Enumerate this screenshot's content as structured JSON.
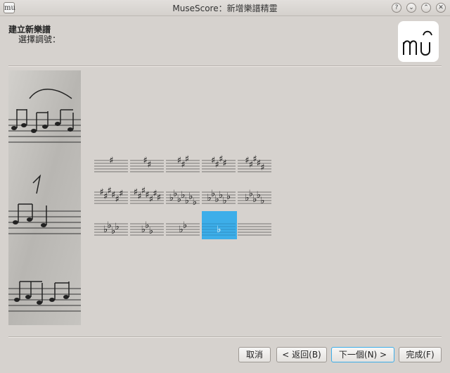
{
  "window": {
    "title": "MuseScore：新增樂譜精靈",
    "app_icon_text": "mu",
    "controls": {
      "help": "?",
      "minimize": "⌄",
      "maximize": "⌃",
      "close": "✕"
    }
  },
  "header": {
    "title": "建立新樂譜",
    "subtitle": "選擇調號："
  },
  "logo": {
    "icon": "musescore-logo"
  },
  "keys": [
    {
      "type": "sharp",
      "count": 1,
      "selected": false
    },
    {
      "type": "sharp",
      "count": 2,
      "selected": false
    },
    {
      "type": "sharp",
      "count": 3,
      "selected": false
    },
    {
      "type": "sharp",
      "count": 4,
      "selected": false
    },
    {
      "type": "sharp",
      "count": 5,
      "selected": false
    },
    {
      "type": "sharp",
      "count": 6,
      "selected": false
    },
    {
      "type": "sharp",
      "count": 7,
      "selected": false
    },
    {
      "type": "flat",
      "count": 7,
      "selected": false
    },
    {
      "type": "flat",
      "count": 6,
      "selected": false
    },
    {
      "type": "flat",
      "count": 5,
      "selected": false
    },
    {
      "type": "flat",
      "count": 4,
      "selected": false
    },
    {
      "type": "flat",
      "count": 3,
      "selected": false
    },
    {
      "type": "flat",
      "count": 2,
      "selected": false
    },
    {
      "type": "flat",
      "count": 1,
      "selected": true
    },
    {
      "type": "none",
      "count": 0,
      "selected": false
    }
  ],
  "buttons": {
    "cancel": "取消",
    "back": "< 返回(B)",
    "next": "下一個(N) >",
    "finish": "完成(F)"
  },
  "colors": {
    "selection": "#3daee9",
    "background": "#d6d2ce"
  }
}
